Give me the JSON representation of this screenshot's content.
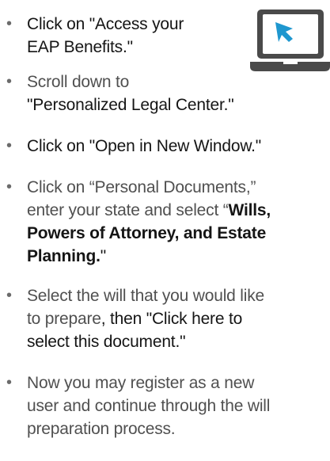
{
  "steps": [
    {
      "bullet": "•",
      "line1": "Click on \"Access your",
      "line2": "EAP Benefits.\""
    },
    {
      "bullet": "•",
      "line1": "Scroll down to",
      "line2": "\"Personalized Legal Center.\""
    },
    {
      "bullet": "•",
      "line1": "Click on \"Open in New Window.\""
    },
    {
      "bullet": "•",
      "line1": "Click on “Personal Documents,”",
      "line2": "enter your state and select “",
      "line2_bold": "Wills,",
      "line3": "Powers of Attorney, and Estate",
      "line4": "Planning.",
      "line4_end": "\""
    },
    {
      "bullet": "•",
      "line1": "Select the will that you would like",
      "line2_a": "to prepare",
      "line2_b": ", then \"Click here to",
      "line3_a": "select this document",
      "line3_b": ".\""
    },
    {
      "bullet": "•",
      "line1": "Now you may register as a new",
      "line2": "user and continue through the will",
      "line3": "preparation process."
    }
  ],
  "icon": {
    "name": "laptop-cursor-icon",
    "screen_color": "#ffffff",
    "body_color": "#4a4a4a",
    "cursor_color": "#1f97cf"
  }
}
